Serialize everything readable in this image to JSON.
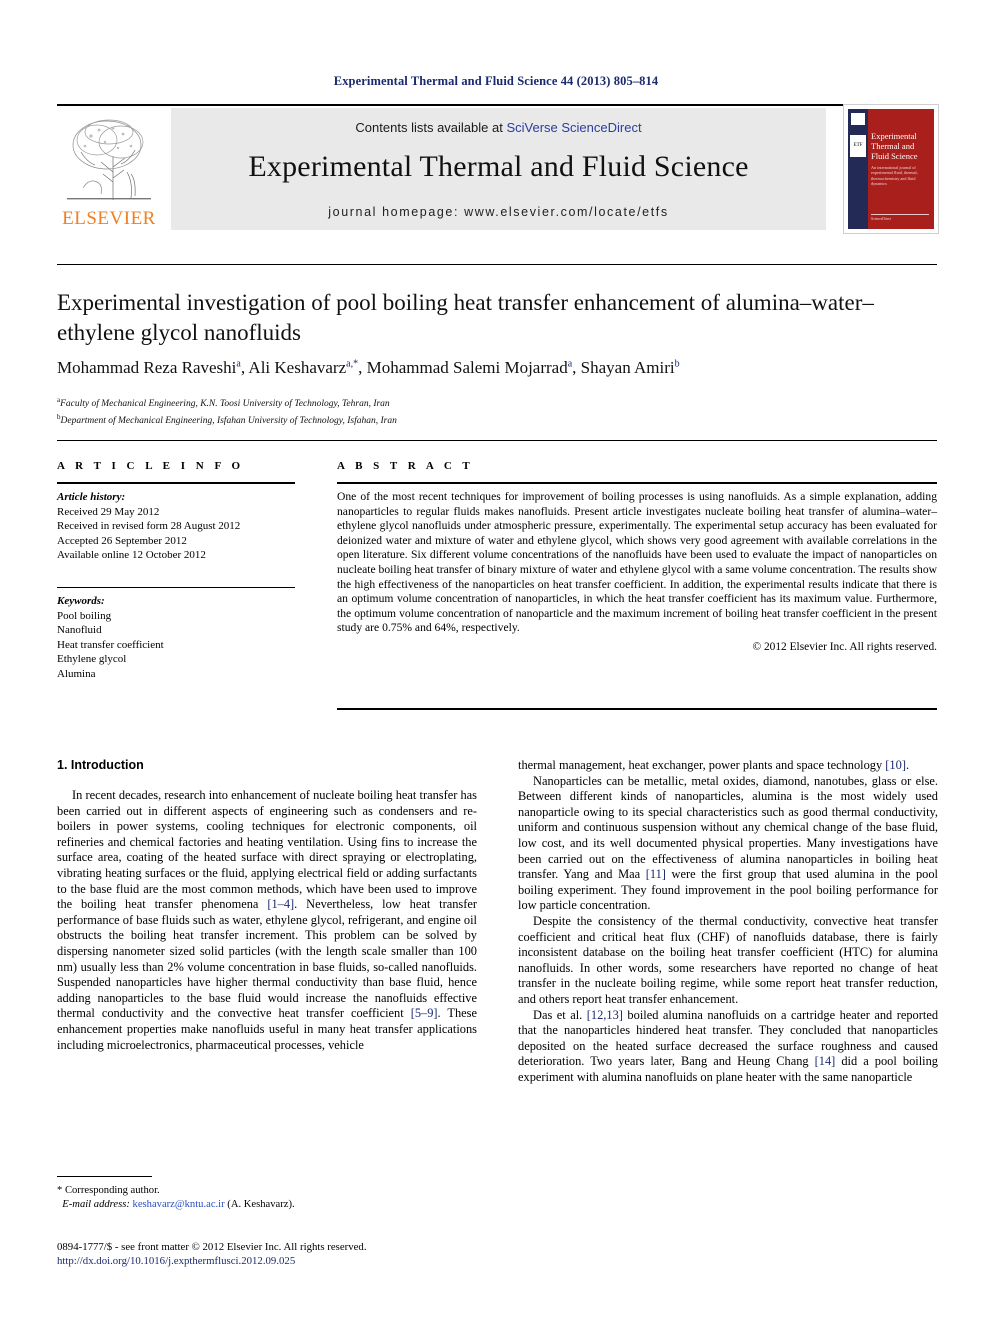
{
  "running_head": "Experimental Thermal and Fluid Science 44 (2013) 805–814",
  "masthead": {
    "publisher_name": "ELSEVIER",
    "contents_prefix": "Contents lists available at ",
    "contents_link": "SciVerse ScienceDirect",
    "journal_title": "Experimental Thermal and Fluid Science",
    "homepage": "journal homepage: www.elsevier.com/locate/etfs",
    "cover": {
      "title": "Experimental Thermal and Fluid Science",
      "subtitle": "An international journal of experimental fluid, thermal, thermochemistry and fluid dynamics",
      "badge": "ETF",
      "footer": "ScienceDirect"
    }
  },
  "article": {
    "title": "Experimental investigation of pool boiling heat transfer enhancement of alumina–water–ethylene glycol nanofluids",
    "authors": [
      {
        "name": "Mohammad Reza Raveshi",
        "sup": "a"
      },
      {
        "name": "Ali Keshavarz",
        "sup": "a,*"
      },
      {
        "name": "Mohammad Salemi Mojarrad",
        "sup": "a"
      },
      {
        "name": "Shayan Amiri",
        "sup": "b"
      }
    ],
    "affiliations": [
      {
        "sup": "a",
        "text": "Faculty of Mechanical Engineering, K.N. Toosi University of Technology, Tehran, Iran"
      },
      {
        "sup": "b",
        "text": "Department of Mechanical Engineering, Isfahan University of Technology, Isfahan, Iran"
      }
    ]
  },
  "article_info": {
    "heading": "A R T I C L E    I N F O",
    "history_label": "Article history:",
    "history": [
      "Received 29 May 2012",
      "Received in revised form 28 August 2012",
      "Accepted 26 September 2012",
      "Available online 12 October 2012"
    ],
    "keywords_label": "Keywords:",
    "keywords": [
      "Pool boiling",
      "Nanofluid",
      "Heat transfer coefficient",
      "Ethylene glycol",
      "Alumina"
    ]
  },
  "abstract": {
    "heading": "A B S T R A C T",
    "text": "One of the most recent techniques for improvement of boiling processes is using nanofluids. As a simple explanation, adding nanoparticles to regular fluids makes nanofluids. Present article investigates nucleate boiling heat transfer of alumina–water–ethylene glycol nanofluids under atmospheric pressure, experimentally. The experimental setup accuracy has been evaluated for deionized water and mixture of water and ethylene glycol, which shows very good agreement with available correlations in the open literature. Six different volume concentrations of the nanofluids have been used to evaluate the impact of nanoparticles on nucleate boiling heat transfer of binary mixture of water and ethylene glycol with a same volume concentration. The results show the high effectiveness of the nanoparticles on heat transfer coefficient. In addition, the experimental results indicate that there is an optimum volume concentration of nanoparticles, in which the heat transfer coefficient has its maximum value. Furthermore, the optimum volume concentration of nanoparticle and the maximum increment of boiling heat transfer coefficient in the present study are 0.75% and 64%, respectively.",
    "copyright": "© 2012 Elsevier Inc. All rights reserved."
  },
  "introduction": {
    "heading": "1. Introduction",
    "left_paragraphs": [
      "In recent decades, research into enhancement of nucleate boiling heat transfer has been carried out in different aspects of engineering such as condensers and re-boilers in power systems, cooling techniques for electronic components, oil refineries and chemical factories and heating ventilation. Using fins to increase the surface area, coating of the heated surface with direct spraying or electroplating, vibrating heating surfaces or the fluid, applying electrical field or adding surfactants to the base fluid are the most common methods, which have been used to improve the boiling heat transfer phenomena [1–4]. Nevertheless, low heat transfer performance of base fluids such as water, ethylene glycol, refrigerant, and engine oil obstructs the boiling heat transfer increment. This problem can be solved by dispersing nanometer sized solid particles (with the length scale smaller than 100 nm) usually less than 2% volume concentration in base fluids, so-called nanofluids. Suspended nanoparticles have higher thermal conductivity than base fluid, hence adding nanoparticles to the base fluid would increase the nanofluids effective thermal conductivity and the convective heat transfer coefficient [5–9]. These enhancement properties make nanofluids useful in many heat transfer applications including microelectronics, pharmaceutical processes, vehicle"
    ],
    "right_paragraphs": [
      "thermal management, heat exchanger, power plants and space technology [10].",
      "Nanoparticles can be metallic, metal oxides, diamond, nanotubes, glass or else. Between different kinds of nanoparticles, alumina is the most widely used nanoparticle owing to its special characteristics such as good thermal conductivity, uniform and continuous suspension without any chemical change of the base fluid, low cost, and its well documented physical properties. Many investigations have been carried out on the effectiveness of alumina nanoparticles in boiling heat transfer. Yang and Maa [11] were the first group that used alumina in the pool boiling experiment. They found improvement in the pool boiling performance for low particle concentration.",
      "Despite the consistency of the thermal conductivity, convective heat transfer coefficient and critical heat flux (CHF) of nanofluids database, there is fairly inconsistent database on the boiling heat transfer coefficient (HTC) for alumina nanofluids. In other words, some researchers have reported no change of heat transfer in the nucleate boiling regime, while some report heat transfer reduction, and others report heat transfer enhancement.",
      "Das et al. [12,13] boiled alumina nanofluids on a cartridge heater and reported that the nanoparticles hindered heat transfer. They concluded that nanoparticles deposited on the heated surface decreased the surface roughness and caused deterioration. Two years later, Bang and Heung Chang [14] did a pool boiling experiment with alumina nanofluids on plane heater with the same nanoparticle"
    ]
  },
  "footnote": {
    "corresponding": "* Corresponding author.",
    "email_label": "E-mail address:",
    "email": "keshavarz@kntu.ac.ir",
    "email_suffix": " (A. Keshavarz)."
  },
  "footer": {
    "issn_line": "0894-1777/$ - see front matter © 2012 Elsevier Inc. All rights reserved.",
    "doi": "http://dx.doi.org/10.1016/j.expthermflusci.2012.09.025"
  },
  "colors": {
    "link_blue": "#2a3da0",
    "ref_blue": "#1a2a6c",
    "elsevier_orange": "#f07f20",
    "cover_red": "#a81f1c",
    "cover_navy": "#232a55",
    "banner_gray": "#e9e9e9"
  }
}
